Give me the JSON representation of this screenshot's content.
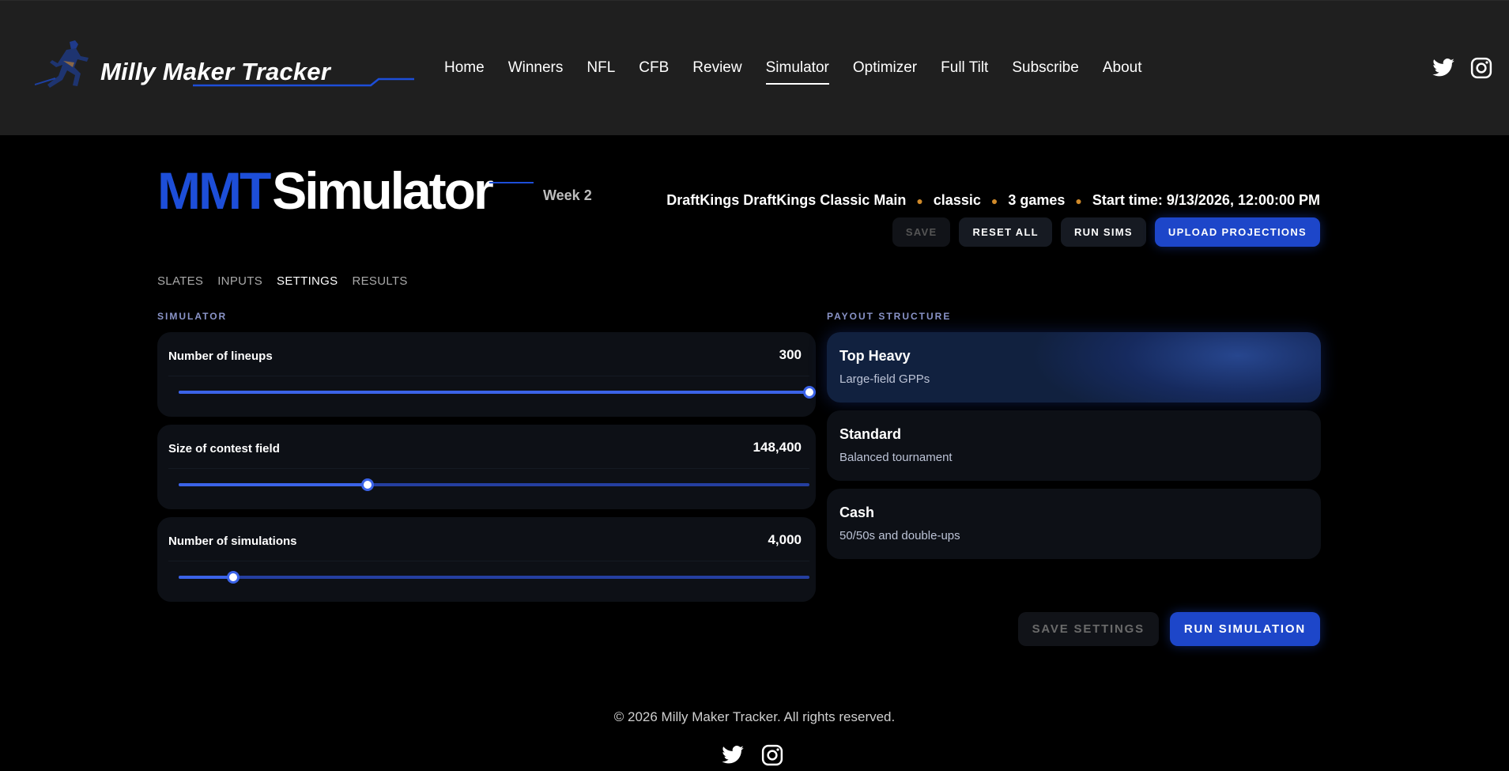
{
  "brand": {
    "name": "Milly Maker Tracker",
    "accent": "#1d4ed8"
  },
  "nav": [
    {
      "label": "Home"
    },
    {
      "label": "Winners"
    },
    {
      "label": "NFL"
    },
    {
      "label": "CFB"
    },
    {
      "label": "Review"
    },
    {
      "label": "Simulator",
      "active": true
    },
    {
      "label": "Optimizer"
    },
    {
      "label": "Full Tilt"
    },
    {
      "label": "Subscribe"
    },
    {
      "label": "About"
    }
  ],
  "page": {
    "title_prefix": "MMT",
    "title_main": "Simulator",
    "week": "Week 2",
    "slate": {
      "name": "DraftKings DraftKings Classic Main",
      "type": "classic",
      "games": "3 games",
      "start": "Start time: 9/13/2026, 12:00:00 PM"
    },
    "actions": {
      "save": "SAVE",
      "reset": "RESET ALL",
      "run_sims": "RUN SIMS",
      "upload": "UPLOAD PROJECTIONS"
    }
  },
  "tabs": [
    {
      "label": "SLATES"
    },
    {
      "label": "INPUTS"
    },
    {
      "label": "SETTINGS",
      "active": true
    },
    {
      "label": "RESULTS"
    }
  ],
  "simulator": {
    "section_label": "SIMULATOR",
    "sliders": [
      {
        "label": "Number of lineups",
        "value": "300",
        "fraction": 1.0
      },
      {
        "label": "Size of contest field",
        "value": "148,400",
        "fraction": 0.3
      },
      {
        "label": "Number of simulations",
        "value": "4,000",
        "fraction": 0.086
      }
    ]
  },
  "payout": {
    "section_label": "PAYOUT STRUCTURE",
    "options": [
      {
        "title": "Top Heavy",
        "subtitle": "Large-field GPPs",
        "selected": true
      },
      {
        "title": "Standard",
        "subtitle": "Balanced tournament",
        "selected": false
      },
      {
        "title": "Cash",
        "subtitle": "50/50s and double-ups",
        "selected": false
      }
    ]
  },
  "bottom_actions": {
    "save_settings": "SAVE SETTINGS",
    "run_simulation": "RUN SIMULATION"
  },
  "footer": {
    "copyright": "© 2026 Milly Maker Tracker. All rights reserved."
  },
  "icons": {
    "logo": "runner-logo-icon",
    "twitter": "twitter-icon",
    "instagram": "instagram-icon"
  }
}
